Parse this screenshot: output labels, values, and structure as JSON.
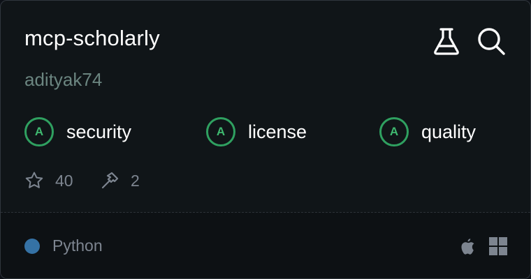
{
  "server": {
    "name": "mcp-scholarly",
    "author": "adityak74"
  },
  "header_icons": [
    {
      "icon": "flask-icon"
    },
    {
      "icon": "search-icon"
    }
  ],
  "grades": [
    {
      "grade": "A",
      "label": "security"
    },
    {
      "grade": "A",
      "label": "license"
    },
    {
      "grade": "A",
      "label": "quality"
    }
  ],
  "stats": {
    "stars": "40",
    "tools": "2"
  },
  "footer": {
    "language": "Python",
    "language_color": "#3572a5",
    "platforms": [
      "apple-icon",
      "windows-icon"
    ]
  },
  "colors": {
    "background": "#101518",
    "grade_accent": "#2fa060",
    "muted_text": "#7d8590"
  }
}
